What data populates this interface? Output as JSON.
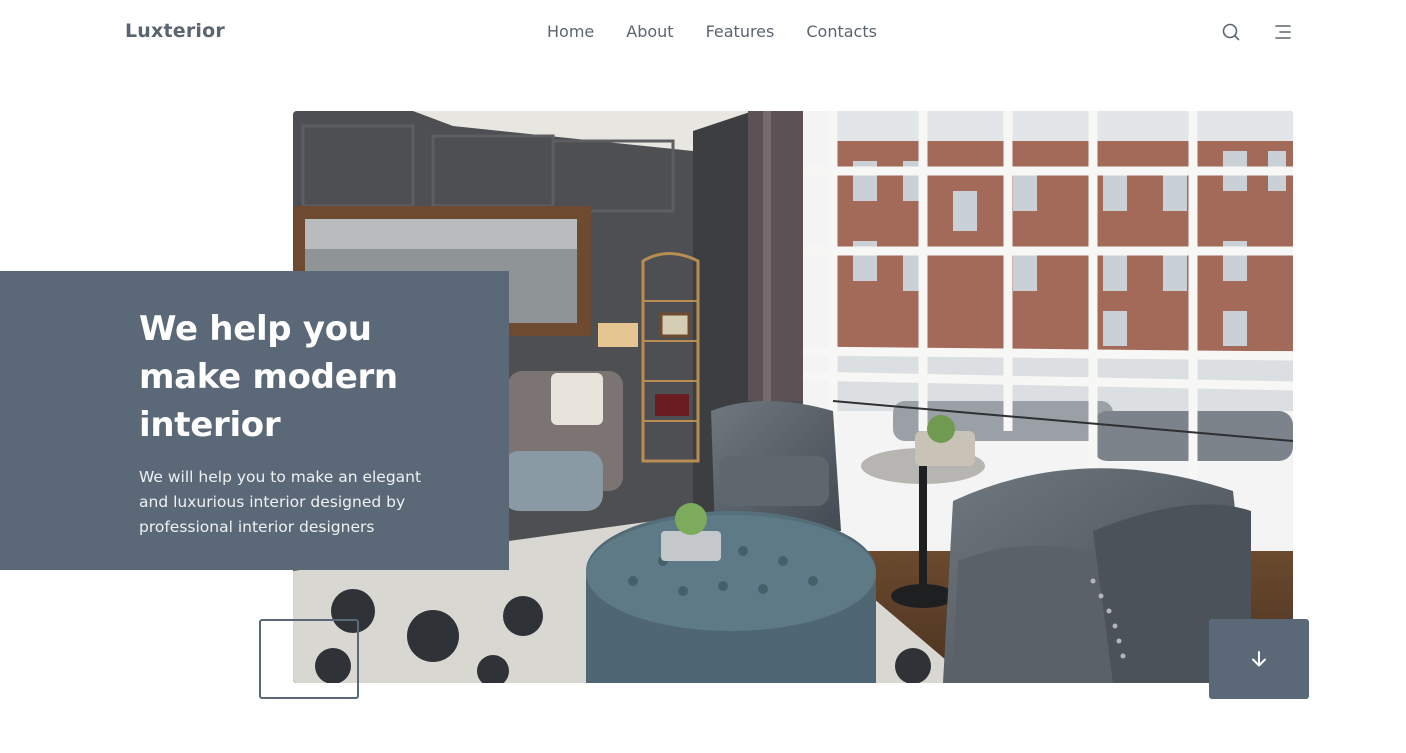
{
  "header": {
    "logo": "Luxterior",
    "nav": [
      {
        "label": "Home"
      },
      {
        "label": "About"
      },
      {
        "label": "Features"
      },
      {
        "label": "Contacts"
      }
    ],
    "icons": [
      "search-icon",
      "menu-icon"
    ]
  },
  "hero": {
    "title": "We help you make modern interior",
    "description": "We will help you to make an elegant and luxurious interior designed by professional interior designers",
    "scroll_icon": "arrow-down-icon"
  },
  "colors": {
    "accent": "#5a6877",
    "text": "#5b6572",
    "background": "#ffffff"
  }
}
